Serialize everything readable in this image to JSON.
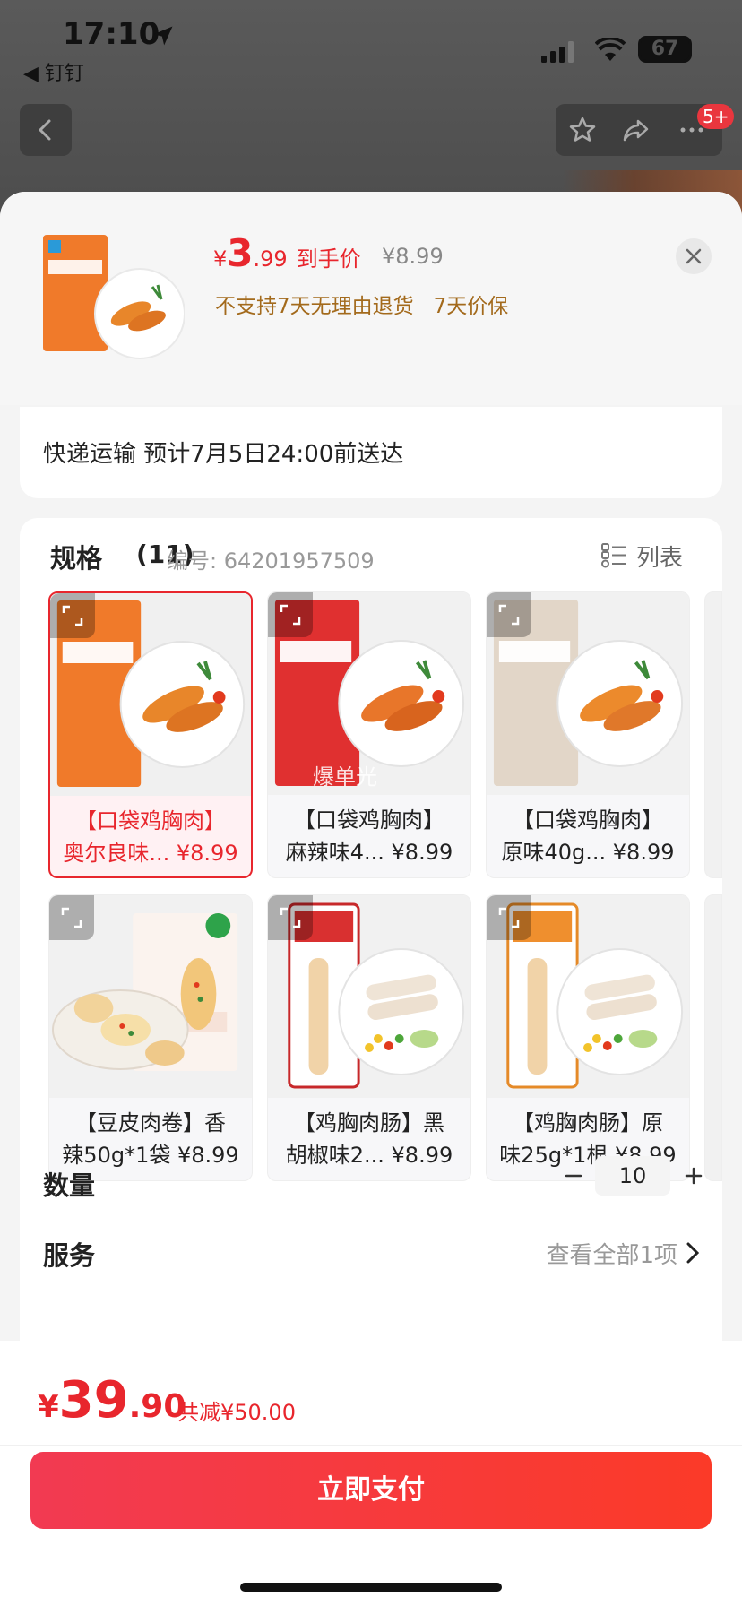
{
  "status_bar": {
    "time": "17:10",
    "back_app": "◀ 钉钉",
    "battery": "67"
  },
  "nav": {
    "badge": "5+"
  },
  "product": {
    "price_yen": "¥",
    "price_int": "3",
    "price_dec": ".99",
    "price_tag": "到手价",
    "original_price": "¥8.99",
    "policy": "不支持7天无理由退货   7天价保"
  },
  "delivery": {
    "text": "快递运输 预计7月5日24:00前送达"
  },
  "spec": {
    "title": "规格",
    "count": "(11)",
    "code": "编号: 64201957509",
    "list_label": "列表",
    "items": [
      {
        "line1": "【口袋鸡胸肉】",
        "line2": "奥尔良味... ¥8.99",
        "theme": "orange",
        "selected": true
      },
      {
        "line1": "【口袋鸡胸肉】",
        "line2": "麻辣味4... ¥8.99",
        "theme": "red",
        "selected": false,
        "watermark": "爆单光"
      },
      {
        "line1": "【口袋鸡胸肉】",
        "line2": "原味40g... ¥8.99",
        "theme": "beige",
        "selected": false
      },
      {
        "line1": "【豆皮肉卷】香",
        "line2": "辣50g*1袋 ¥8.99",
        "theme": "roll",
        "selected": false
      },
      {
        "line1": "【鸡胸肉肠】黑",
        "line2": "胡椒味2... ¥8.99",
        "theme": "sausage-red",
        "selected": false
      },
      {
        "line1": "【鸡胸肉肠】原",
        "line2": "味25g*1根 ¥8.99",
        "theme": "sausage-orange",
        "selected": false
      }
    ]
  },
  "quantity": {
    "label": "数量",
    "value": "10",
    "minus": "−",
    "plus": "+"
  },
  "service": {
    "label": "服务",
    "link": "查看全部1项"
  },
  "checkout": {
    "yen": "¥",
    "total_int": "39",
    "total_dec": ".90",
    "discount": "共减¥50.00",
    "pay_label": "立即支付"
  },
  "colors": {
    "accent": "#e8262d",
    "policy": "#a36a1c"
  }
}
